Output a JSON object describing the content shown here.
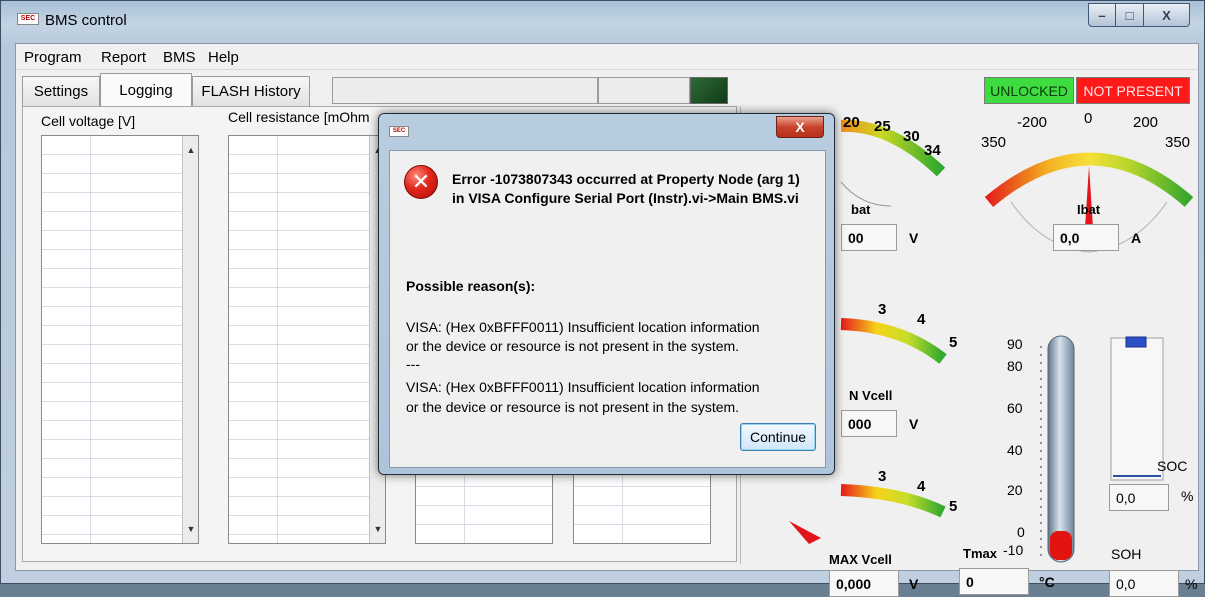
{
  "window": {
    "title": "BMS control",
    "logo_text": "SEC",
    "controls": {
      "minimize": "–",
      "maximize": "□",
      "close": "X"
    }
  },
  "menu": [
    "Program",
    "Report",
    "BMS",
    "Help"
  ],
  "tabs": [
    {
      "label": "Settings",
      "active": false
    },
    {
      "label": "Logging",
      "active": true
    },
    {
      "label": "FLASH History",
      "active": false
    }
  ],
  "status": {
    "lock": {
      "label": "UNLOCKED",
      "color": "#3fdc3f"
    },
    "connection": {
      "label": "NOT PRESENT",
      "color": "#ff1a1a"
    }
  },
  "logging": {
    "cell_voltage_label": "Cell voltage [V]",
    "cell_resistance_label": "Cell resistance [mOhm"
  },
  "meters": {
    "ubat": {
      "label": "bat",
      "value": "00",
      "unit": "V",
      "scale_visible": [
        "20",
        "25",
        "30",
        "34"
      ]
    },
    "ibat": {
      "label": "Ibat",
      "value": "0,0",
      "unit": "A",
      "scale": [
        "-200",
        "0",
        "200",
        "350",
        "350"
      ]
    },
    "min_vcell": {
      "label": "N Vcell",
      "value": "000",
      "unit": "V",
      "scale_visible": [
        "3",
        "4",
        "5"
      ]
    },
    "max_vcell": {
      "label": "MAX Vcell",
      "value": "0,000",
      "unit": "V",
      "scale_visible": [
        "3",
        "4",
        "5"
      ]
    },
    "tmax": {
      "label": "Tmax",
      "value": "0",
      "unit": "°C",
      "scale": [
        "90",
        "80",
        "60",
        "40",
        "20",
        "0",
        "-10"
      ],
      "level": -10
    },
    "soc": {
      "label": "SOC",
      "value": "0,0",
      "unit": "%",
      "fill_percent": 0
    },
    "soh": {
      "label": "SOH",
      "value": "0,0",
      "unit": "%"
    }
  },
  "dialog": {
    "logo_text": "SEC",
    "close_glyph": "X",
    "icon_glyph": "✕",
    "error_title": "Error -1073807343 occurred at Property Node (arg 1) in VISA Configure Serial Port (Instr).vi->Main BMS.vi",
    "reason_heading": "Possible reason(s):",
    "reason_lines": [
      "VISA:  (Hex 0xBFFF0011) Insufficient location information",
      "or the device or resource is not present in the system.",
      "---",
      "VISA:  (Hex 0xBFFF0011) Insufficient location information",
      "or the device or resource is not present in the system."
    ],
    "continue_label": "Continue"
  }
}
